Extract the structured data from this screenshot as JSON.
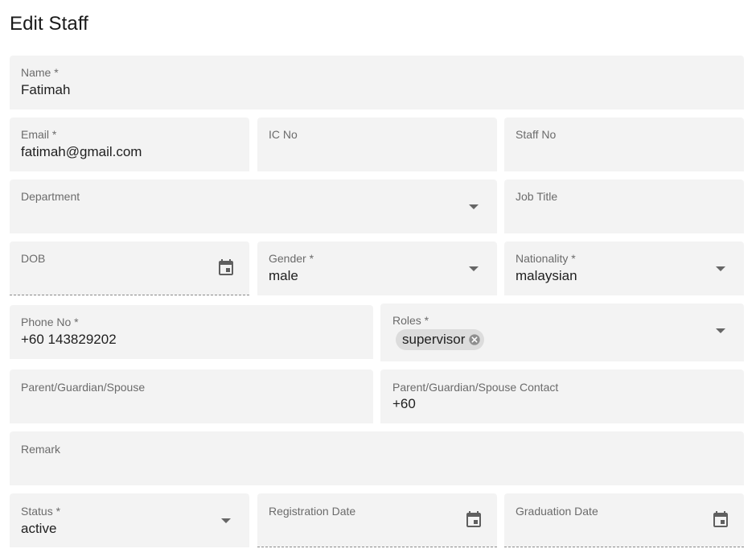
{
  "page": {
    "title": "Edit Staff"
  },
  "form": {
    "name": {
      "label": "Name *",
      "value": "Fatimah"
    },
    "email": {
      "label": "Email *",
      "value": "fatimah@gmail.com"
    },
    "ic_no": {
      "label": "IC No",
      "value": ""
    },
    "staff_no": {
      "label": "Staff No",
      "value": ""
    },
    "department": {
      "label": "Department",
      "value": ""
    },
    "job_title": {
      "label": "Job Title",
      "value": ""
    },
    "dob": {
      "label": "DOB",
      "value": "",
      "icon": "calendar-icon"
    },
    "gender": {
      "label": "Gender *",
      "value": "male"
    },
    "nationality": {
      "label": "Nationality *",
      "value": "malaysian"
    },
    "phone": {
      "label": "Phone No *",
      "value": "+60 143829202"
    },
    "roles": {
      "label": "Roles *",
      "chips": [
        "supervisor"
      ]
    },
    "guardian": {
      "label": "Parent/Guardian/Spouse",
      "value": ""
    },
    "guardian_contact": {
      "label": "Parent/Guardian/Spouse Contact",
      "value": "+60"
    },
    "remark": {
      "label": "Remark",
      "value": ""
    },
    "status": {
      "label": "Status *",
      "value": "active"
    },
    "registration_date": {
      "label": "Registration Date",
      "value": "",
      "icon": "calendar-icon"
    },
    "graduation_date": {
      "label": "Graduation Date",
      "value": "",
      "icon": "calendar-icon"
    }
  },
  "colors": {
    "field_bg": "#f3f3f3",
    "label": "#6b6b6b",
    "icon": "#5f5f5f",
    "chip_bg": "#dcdcdc"
  }
}
